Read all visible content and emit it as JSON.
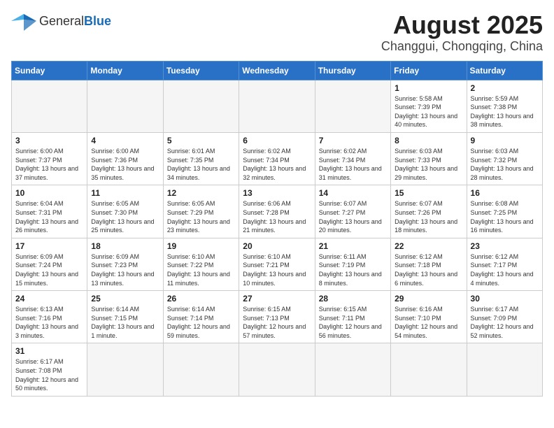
{
  "header": {
    "logo_general": "General",
    "logo_blue": "Blue",
    "month_title": "August 2025",
    "location": "Changgui, Chongqing, China"
  },
  "weekdays": [
    "Sunday",
    "Monday",
    "Tuesday",
    "Wednesday",
    "Thursday",
    "Friday",
    "Saturday"
  ],
  "days": [
    {
      "date": "",
      "info": ""
    },
    {
      "date": "",
      "info": ""
    },
    {
      "date": "",
      "info": ""
    },
    {
      "date": "",
      "info": ""
    },
    {
      "date": "",
      "info": ""
    },
    {
      "date": "1",
      "info": "Sunrise: 5:58 AM\nSunset: 7:39 PM\nDaylight: 13 hours and 40 minutes."
    },
    {
      "date": "2",
      "info": "Sunrise: 5:59 AM\nSunset: 7:38 PM\nDaylight: 13 hours and 38 minutes."
    },
    {
      "date": "3",
      "info": "Sunrise: 6:00 AM\nSunset: 7:37 PM\nDaylight: 13 hours and 37 minutes."
    },
    {
      "date": "4",
      "info": "Sunrise: 6:00 AM\nSunset: 7:36 PM\nDaylight: 13 hours and 35 minutes."
    },
    {
      "date": "5",
      "info": "Sunrise: 6:01 AM\nSunset: 7:35 PM\nDaylight: 13 hours and 34 minutes."
    },
    {
      "date": "6",
      "info": "Sunrise: 6:02 AM\nSunset: 7:34 PM\nDaylight: 13 hours and 32 minutes."
    },
    {
      "date": "7",
      "info": "Sunrise: 6:02 AM\nSunset: 7:34 PM\nDaylight: 13 hours and 31 minutes."
    },
    {
      "date": "8",
      "info": "Sunrise: 6:03 AM\nSunset: 7:33 PM\nDaylight: 13 hours and 29 minutes."
    },
    {
      "date": "9",
      "info": "Sunrise: 6:03 AM\nSunset: 7:32 PM\nDaylight: 13 hours and 28 minutes."
    },
    {
      "date": "10",
      "info": "Sunrise: 6:04 AM\nSunset: 7:31 PM\nDaylight: 13 hours and 26 minutes."
    },
    {
      "date": "11",
      "info": "Sunrise: 6:05 AM\nSunset: 7:30 PM\nDaylight: 13 hours and 25 minutes."
    },
    {
      "date": "12",
      "info": "Sunrise: 6:05 AM\nSunset: 7:29 PM\nDaylight: 13 hours and 23 minutes."
    },
    {
      "date": "13",
      "info": "Sunrise: 6:06 AM\nSunset: 7:28 PM\nDaylight: 13 hours and 21 minutes."
    },
    {
      "date": "14",
      "info": "Sunrise: 6:07 AM\nSunset: 7:27 PM\nDaylight: 13 hours and 20 minutes."
    },
    {
      "date": "15",
      "info": "Sunrise: 6:07 AM\nSunset: 7:26 PM\nDaylight: 13 hours and 18 minutes."
    },
    {
      "date": "16",
      "info": "Sunrise: 6:08 AM\nSunset: 7:25 PM\nDaylight: 13 hours and 16 minutes."
    },
    {
      "date": "17",
      "info": "Sunrise: 6:09 AM\nSunset: 7:24 PM\nDaylight: 13 hours and 15 minutes."
    },
    {
      "date": "18",
      "info": "Sunrise: 6:09 AM\nSunset: 7:23 PM\nDaylight: 13 hours and 13 minutes."
    },
    {
      "date": "19",
      "info": "Sunrise: 6:10 AM\nSunset: 7:22 PM\nDaylight: 13 hours and 11 minutes."
    },
    {
      "date": "20",
      "info": "Sunrise: 6:10 AM\nSunset: 7:21 PM\nDaylight: 13 hours and 10 minutes."
    },
    {
      "date": "21",
      "info": "Sunrise: 6:11 AM\nSunset: 7:19 PM\nDaylight: 13 hours and 8 minutes."
    },
    {
      "date": "22",
      "info": "Sunrise: 6:12 AM\nSunset: 7:18 PM\nDaylight: 13 hours and 6 minutes."
    },
    {
      "date": "23",
      "info": "Sunrise: 6:12 AM\nSunset: 7:17 PM\nDaylight: 13 hours and 4 minutes."
    },
    {
      "date": "24",
      "info": "Sunrise: 6:13 AM\nSunset: 7:16 PM\nDaylight: 13 hours and 3 minutes."
    },
    {
      "date": "25",
      "info": "Sunrise: 6:14 AM\nSunset: 7:15 PM\nDaylight: 13 hours and 1 minute."
    },
    {
      "date": "26",
      "info": "Sunrise: 6:14 AM\nSunset: 7:14 PM\nDaylight: 12 hours and 59 minutes."
    },
    {
      "date": "27",
      "info": "Sunrise: 6:15 AM\nSunset: 7:13 PM\nDaylight: 12 hours and 57 minutes."
    },
    {
      "date": "28",
      "info": "Sunrise: 6:15 AM\nSunset: 7:11 PM\nDaylight: 12 hours and 56 minutes."
    },
    {
      "date": "29",
      "info": "Sunrise: 6:16 AM\nSunset: 7:10 PM\nDaylight: 12 hours and 54 minutes."
    },
    {
      "date": "30",
      "info": "Sunrise: 6:17 AM\nSunset: 7:09 PM\nDaylight: 12 hours and 52 minutes."
    },
    {
      "date": "31",
      "info": "Sunrise: 6:17 AM\nSunset: 7:08 PM\nDaylight: 12 hours and 50 minutes."
    },
    {
      "date": "",
      "info": ""
    },
    {
      "date": "",
      "info": ""
    },
    {
      "date": "",
      "info": ""
    },
    {
      "date": "",
      "info": ""
    },
    {
      "date": "",
      "info": ""
    },
    {
      "date": "",
      "info": ""
    }
  ]
}
